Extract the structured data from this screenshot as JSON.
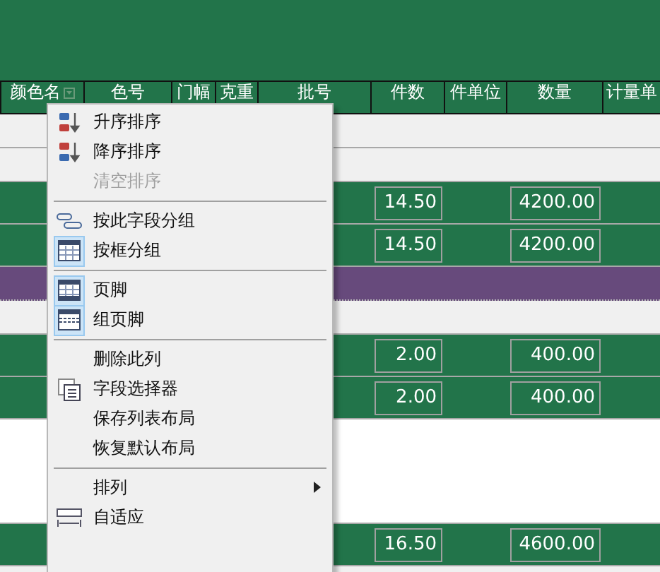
{
  "columns": [
    {
      "label": "颜色名",
      "filter": true
    },
    {
      "label": "色号"
    },
    {
      "label": "门幅"
    },
    {
      "label": "克重"
    },
    {
      "label": "批号"
    },
    {
      "label": "件数"
    },
    {
      "label": "件单位"
    },
    {
      "label": "数量"
    },
    {
      "label": "计量单"
    }
  ],
  "rows": [
    {
      "kind": "blank"
    },
    {
      "kind": "blank"
    },
    {
      "kind": "detail",
      "pieces": "14.50",
      "quantity": "4200.00"
    },
    {
      "kind": "detail",
      "pieces": "14.50",
      "quantity": "4200.00"
    },
    {
      "kind": "group"
    },
    {
      "kind": "blank"
    },
    {
      "kind": "detail",
      "pieces": "2.00",
      "quantity": "400.00"
    },
    {
      "kind": "detail",
      "pieces": "2.00",
      "quantity": "400.00"
    },
    {
      "kind": "empty"
    },
    {
      "kind": "detail",
      "pieces": "16.50",
      "quantity": "4600.00"
    }
  ],
  "menu": [
    {
      "kind": "item",
      "label": "升序排序",
      "disabled": false,
      "checked": false
    },
    {
      "kind": "item",
      "label": "降序排序",
      "disabled": false,
      "checked": false
    },
    {
      "kind": "item",
      "label": "清空排序",
      "disabled": true,
      "checked": false
    },
    {
      "kind": "separator"
    },
    {
      "kind": "item",
      "label": "按此字段分组",
      "disabled": false,
      "checked": false
    },
    {
      "kind": "item",
      "label": "按框分组",
      "disabled": false,
      "checked": true
    },
    {
      "kind": "separator"
    },
    {
      "kind": "item",
      "label": "页脚",
      "disabled": false,
      "checked": true
    },
    {
      "kind": "item",
      "label": "组页脚",
      "disabled": false,
      "checked": true
    },
    {
      "kind": "separator"
    },
    {
      "kind": "item",
      "label": "删除此列",
      "disabled": false,
      "checked": false
    },
    {
      "kind": "item",
      "label": "字段选择器",
      "disabled": false,
      "checked": false
    },
    {
      "kind": "item",
      "label": "保存列表布局",
      "disabled": false,
      "checked": false
    },
    {
      "kind": "item",
      "label": "恢复默认布局",
      "disabled": false,
      "checked": false
    },
    {
      "kind": "separator"
    },
    {
      "kind": "submenu",
      "label": "排列",
      "disabled": false,
      "checked": false
    },
    {
      "kind": "item",
      "label": "自适应",
      "disabled": false,
      "checked": false
    }
  ]
}
